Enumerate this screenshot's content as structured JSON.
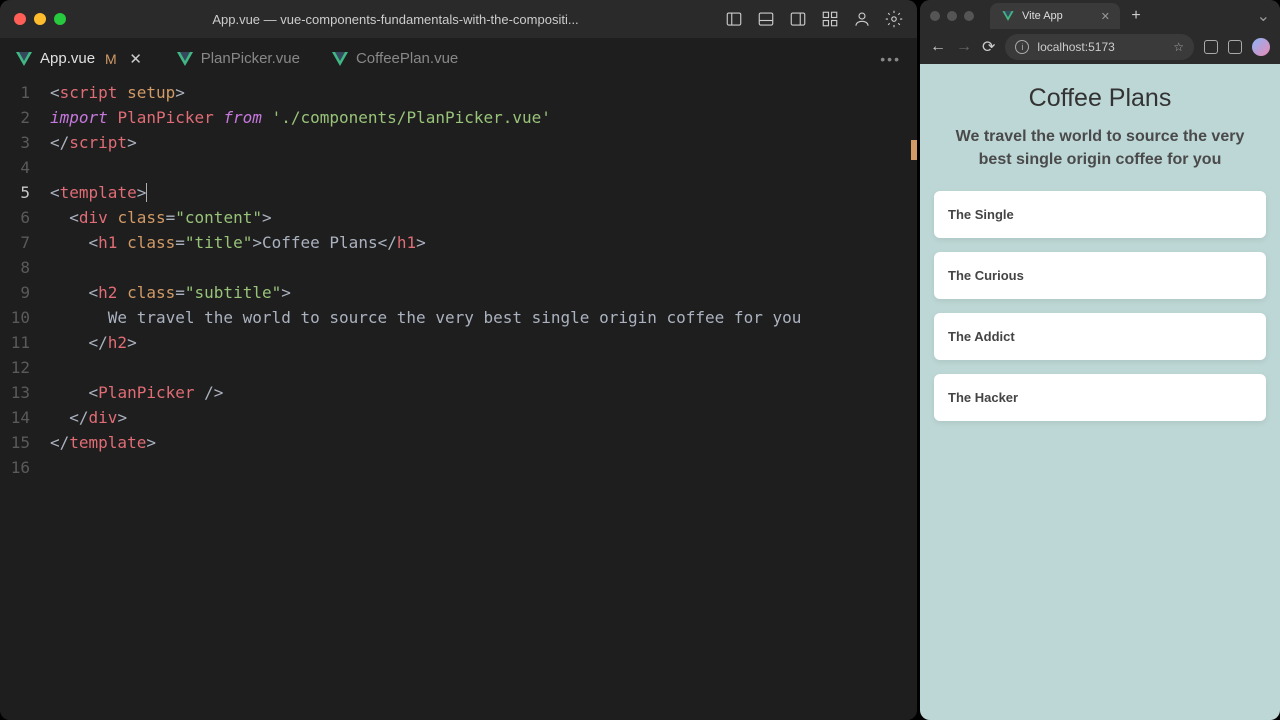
{
  "editor": {
    "title": "App.vue — vue-components-fundamentals-with-the-compositi...",
    "tabs": [
      {
        "label": "App.vue",
        "modified": "M",
        "active": true
      },
      {
        "label": "PlanPicker.vue",
        "active": false
      },
      {
        "label": "CoffeePlan.vue",
        "active": false
      }
    ],
    "line_numbers": [
      "1",
      "2",
      "3",
      "4",
      "5",
      "6",
      "7",
      "8",
      "9",
      "10",
      "11",
      "12",
      "13",
      "14",
      "15",
      "16"
    ],
    "active_line": 5,
    "code": {
      "script_open": "<script setup>",
      "import_keyword": "import",
      "import_name": "PlanPicker",
      "from_keyword": "from",
      "import_path": "'./components/PlanPicker.vue'",
      "script_close_open": "</",
      "script_close_tag": "script",
      "template_open": "<template>",
      "div_class": "content",
      "h1_class": "title",
      "h1_text": "Coffee Plans",
      "h2_class": "subtitle",
      "h2_text": "We travel the world to source the very best single origin coffee for you",
      "plan_picker": "<PlanPicker />",
      "template_close": "</template>"
    }
  },
  "browser": {
    "tab_title": "Vite App",
    "url": "localhost:5173",
    "page": {
      "title": "Coffee Plans",
      "subtitle": "We travel the world to source the very best single origin coffee for you",
      "plans": [
        "The Single",
        "The Curious",
        "The Addict",
        "The Hacker"
      ]
    }
  }
}
